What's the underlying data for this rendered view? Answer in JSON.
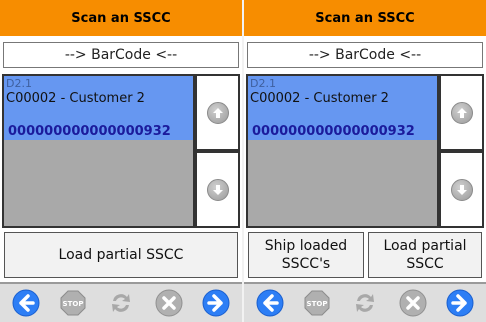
{
  "screens": [
    {
      "title": "Scan an SSCC",
      "barcode_field": "--> BarCode <--",
      "list": {
        "selected_item": {
          "code": "D2.1",
          "customer": "C00002 - Customer 2",
          "sscc": "000000000000000932"
        }
      },
      "buttons": {
        "load_partial": "Load partial SSCC"
      },
      "toolbar": [
        "back-icon",
        "stop-icon",
        "refresh-icon",
        "cancel-icon",
        "forward-icon"
      ]
    },
    {
      "title": "Scan an SSCC",
      "barcode_field": "--> BarCode <--",
      "list": {
        "selected_item": {
          "code": "D2.1",
          "customer": "C00002 - Customer 2",
          "sscc": "000000000000000932"
        }
      },
      "buttons": {
        "ship_loaded_line1": "Ship loaded",
        "ship_loaded_line2": "SSCC's",
        "load_partial_line1": "Load partial",
        "load_partial_line2": "SSCC"
      },
      "toolbar": [
        "back-icon",
        "stop-icon",
        "refresh-icon",
        "cancel-icon",
        "forward-icon"
      ]
    }
  ],
  "colors": {
    "title_bar": "#f78d00",
    "selected_row": "#6697f1",
    "list_background": "#a9a9a9",
    "sscc_text": "#1b1b9c",
    "nav_arrow": "#2d7ef5"
  }
}
